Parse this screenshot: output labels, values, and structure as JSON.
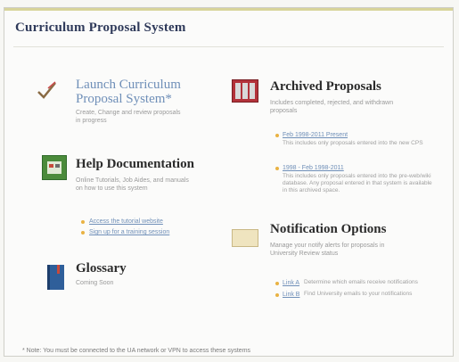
{
  "header": {
    "title": "Curriculum Proposal System"
  },
  "launch": {
    "title": "Launch Curriculum Proposal System*",
    "desc": "Create, Change and review proposals in progress"
  },
  "help": {
    "title": "Help Documentation",
    "desc": "Online Tutorials, Job Aides, and manuals on how to use this system",
    "links": [
      "Access the tutorial website",
      "Sign up for a training session"
    ]
  },
  "glossary": {
    "title": "Glossary",
    "desc": "Coming Soon"
  },
  "archived": {
    "title": "Archived Proposals",
    "desc": "Includes completed, rejected, and withdrawn proposals",
    "items": [
      {
        "link": "Feb 1998-2011 Present",
        "desc": "This includes only proposals entered into the new CPS"
      },
      {
        "link": "1998 - Feb 1998-2011",
        "desc": "This includes only proposals entered into the pre-web/wiki database. Any proposal entered in that system is available in this archived space."
      }
    ]
  },
  "notify": {
    "title": "Notification Options",
    "desc": "Manage your notify alerts for proposals in University Review status",
    "items": [
      {
        "link": "Link A",
        "desc": "Determine which emails receive notifications"
      },
      {
        "link": "Link B",
        "desc": "Find University emails to your notifications"
      }
    ]
  },
  "footer": {
    "note": "* Note: You must be connected to the UA network or VPN to access these systems"
  }
}
